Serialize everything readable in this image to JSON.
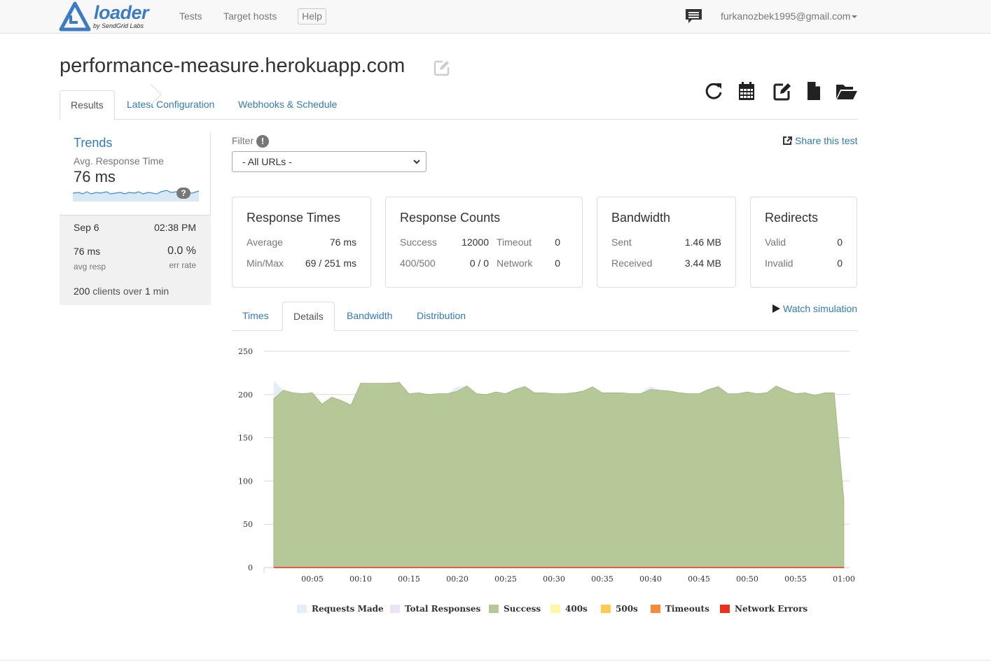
{
  "nav": {
    "logo_word": "loader",
    "logo_sub": "by SendGrid Labs",
    "tests": "Tests",
    "target_hosts": "Target hosts",
    "help": "Help",
    "user": "furkanozbek1995@gmail.com"
  },
  "page": {
    "title": "performance-measure.herokuapp.com"
  },
  "tabs": [
    "Results",
    "Latest Configuration",
    "Webhooks & Schedule"
  ],
  "trends": {
    "title": "Trends",
    "label": "Avg. Response Time",
    "value": "76 ms",
    "badge": "?",
    "run": {
      "date": "Sep 6",
      "time": "02:38 PM",
      "resp": "76 ms",
      "resp_label": "avg resp",
      "err": "0.0 %",
      "err_label": "err rate",
      "clients": "200",
      "clients_mid": "clients over",
      "duration": "1",
      "duration_unit": "min"
    }
  },
  "filter": {
    "label": "Filter",
    "badge": "!",
    "selected": "- All URLs -",
    "share": "Share this test"
  },
  "panels": {
    "response_times": {
      "title": "Response Times",
      "average_label": "Average",
      "average": "76 ms",
      "minmax_label": "Min/Max",
      "minmax": "69 / 251 ms"
    },
    "response_counts": {
      "title": "Response Counts",
      "success_label": "Success",
      "success": "12000",
      "timeout_label": "Timeout",
      "timeout": "0",
      "err_label": "400/500",
      "err": "0 / 0",
      "network_label": "Network",
      "network": "0"
    },
    "bandwidth": {
      "title": "Bandwidth",
      "sent_label": "Sent",
      "sent": "1.46 MB",
      "received_label": "Received",
      "received": "3.44 MB"
    },
    "redirects": {
      "title": "Redirects",
      "valid_label": "Valid",
      "valid": "0",
      "invalid_label": "Invalid",
      "invalid": "0"
    }
  },
  "chart_tabs": [
    "Times",
    "Details",
    "Bandwidth",
    "Distribution"
  ],
  "watch": "Watch simulation",
  "colors": {
    "link": "#337ab7",
    "requests_made": "#e3eef8",
    "total_responses": "#ece4f3",
    "success": "#b6c798",
    "success_line": "#8fa96a",
    "s400": "#fdf8a8",
    "s500": "#fccb55",
    "timeouts": "#f28b3c",
    "network_errors": "#e8321e"
  },
  "chart_data": {
    "type": "area",
    "xlabel": "",
    "ylabel": "",
    "ylim": [
      0,
      250
    ],
    "yticks": [
      0,
      50,
      100,
      150,
      200,
      250
    ],
    "xlim": [
      0,
      60
    ],
    "xticks": [
      5,
      10,
      15,
      20,
      25,
      30,
      35,
      40,
      45,
      50,
      55,
      60
    ],
    "xtick_labels": [
      "00:05",
      "00:10",
      "00:15",
      "00:20",
      "00:25",
      "00:30",
      "00:35",
      "00:40",
      "00:45",
      "00:50",
      "00:55",
      "01:00"
    ],
    "grid": "horizontal",
    "legend": "bottom",
    "x": [
      1,
      2,
      3,
      4,
      5,
      6,
      7,
      8,
      9,
      10,
      11,
      12,
      13,
      14,
      15,
      16,
      17,
      18,
      19,
      20,
      21,
      22,
      23,
      24,
      25,
      26,
      27,
      28,
      29,
      30,
      31,
      32,
      33,
      34,
      35,
      36,
      37,
      38,
      39,
      40,
      41,
      42,
      43,
      44,
      45,
      46,
      47,
      48,
      49,
      50,
      51,
      52,
      53,
      54,
      55,
      56,
      57,
      58,
      59,
      60
    ],
    "series": [
      {
        "name": "Requests Made",
        "values": [
          216,
          205,
          202,
          201,
          202,
          189,
          197,
          193,
          188,
          213,
          213,
          213,
          213,
          214,
          201,
          202,
          200,
          201,
          201,
          209,
          210,
          201,
          200,
          203,
          201,
          207,
          211,
          202,
          202,
          201,
          201,
          202,
          204,
          209,
          202,
          202,
          202,
          201,
          202,
          210,
          205,
          204,
          202,
          201,
          201,
          206,
          211,
          201,
          201,
          203,
          201,
          202,
          210,
          205,
          201,
          202,
          199,
          202,
          202,
          78
        ]
      },
      {
        "name": "Total Responses",
        "values": [
          195,
          205,
          202,
          201,
          202,
          189,
          197,
          193,
          188,
          213,
          213,
          213,
          213,
          214,
          201,
          202,
          200,
          201,
          201,
          204,
          210,
          201,
          200,
          203,
          201,
          206,
          209,
          202,
          202,
          201,
          201,
          202,
          204,
          209,
          202,
          202,
          202,
          201,
          201,
          206,
          205,
          204,
          202,
          201,
          201,
          206,
          209,
          201,
          201,
          203,
          201,
          202,
          210,
          205,
          201,
          202,
          199,
          202,
          202,
          78
        ]
      },
      {
        "name": "Success",
        "values": [
          195,
          205,
          202,
          201,
          202,
          189,
          197,
          193,
          188,
          213,
          213,
          213,
          213,
          214,
          201,
          202,
          200,
          201,
          201,
          204,
          210,
          201,
          200,
          203,
          201,
          206,
          209,
          202,
          202,
          201,
          201,
          202,
          204,
          209,
          202,
          202,
          202,
          201,
          201,
          206,
          205,
          204,
          202,
          201,
          201,
          206,
          209,
          201,
          201,
          203,
          201,
          202,
          210,
          205,
          201,
          202,
          199,
          202,
          202,
          78
        ]
      },
      {
        "name": "400s",
        "values": [
          0,
          0,
          0,
          0,
          0,
          0,
          0,
          0,
          0,
          0,
          0,
          0,
          0,
          0,
          0,
          0,
          0,
          0,
          0,
          0,
          0,
          0,
          0,
          0,
          0,
          0,
          0,
          0,
          0,
          0,
          0,
          0,
          0,
          0,
          0,
          0,
          0,
          0,
          0,
          0,
          0,
          0,
          0,
          0,
          0,
          0,
          0,
          0,
          0,
          0,
          0,
          0,
          0,
          0,
          0,
          0,
          0,
          0,
          0,
          0
        ]
      },
      {
        "name": "500s",
        "values": [
          0,
          0,
          0,
          0,
          0,
          0,
          0,
          0,
          0,
          0,
          0,
          0,
          0,
          0,
          0,
          0,
          0,
          0,
          0,
          0,
          0,
          0,
          0,
          0,
          0,
          0,
          0,
          0,
          0,
          0,
          0,
          0,
          0,
          0,
          0,
          0,
          0,
          0,
          0,
          0,
          0,
          0,
          0,
          0,
          0,
          0,
          0,
          0,
          0,
          0,
          0,
          0,
          0,
          0,
          0,
          0,
          0,
          0,
          0,
          0
        ]
      },
      {
        "name": "Timeouts",
        "values": [
          0,
          0,
          0,
          0,
          0,
          0,
          0,
          0,
          0,
          0,
          0,
          0,
          0,
          0,
          0,
          0,
          0,
          0,
          0,
          0,
          0,
          0,
          0,
          0,
          0,
          0,
          0,
          0,
          0,
          0,
          0,
          0,
          0,
          0,
          0,
          0,
          0,
          0,
          0,
          0,
          0,
          0,
          0,
          0,
          0,
          0,
          0,
          0,
          0,
          0,
          0,
          0,
          0,
          0,
          0,
          0,
          0,
          0,
          0,
          0
        ]
      },
      {
        "name": "Network Errors",
        "values": [
          0,
          0,
          0,
          0,
          0,
          0,
          0,
          0,
          0,
          0,
          0,
          0,
          0,
          0,
          0,
          0,
          0,
          0,
          0,
          0,
          0,
          0,
          0,
          0,
          0,
          0,
          0,
          0,
          0,
          0,
          0,
          0,
          0,
          0,
          0,
          0,
          0,
          0,
          0,
          0,
          0,
          0,
          0,
          0,
          0,
          0,
          0,
          0,
          0,
          0,
          0,
          0,
          0,
          0,
          0,
          0,
          0,
          0,
          0,
          0
        ]
      }
    ]
  }
}
